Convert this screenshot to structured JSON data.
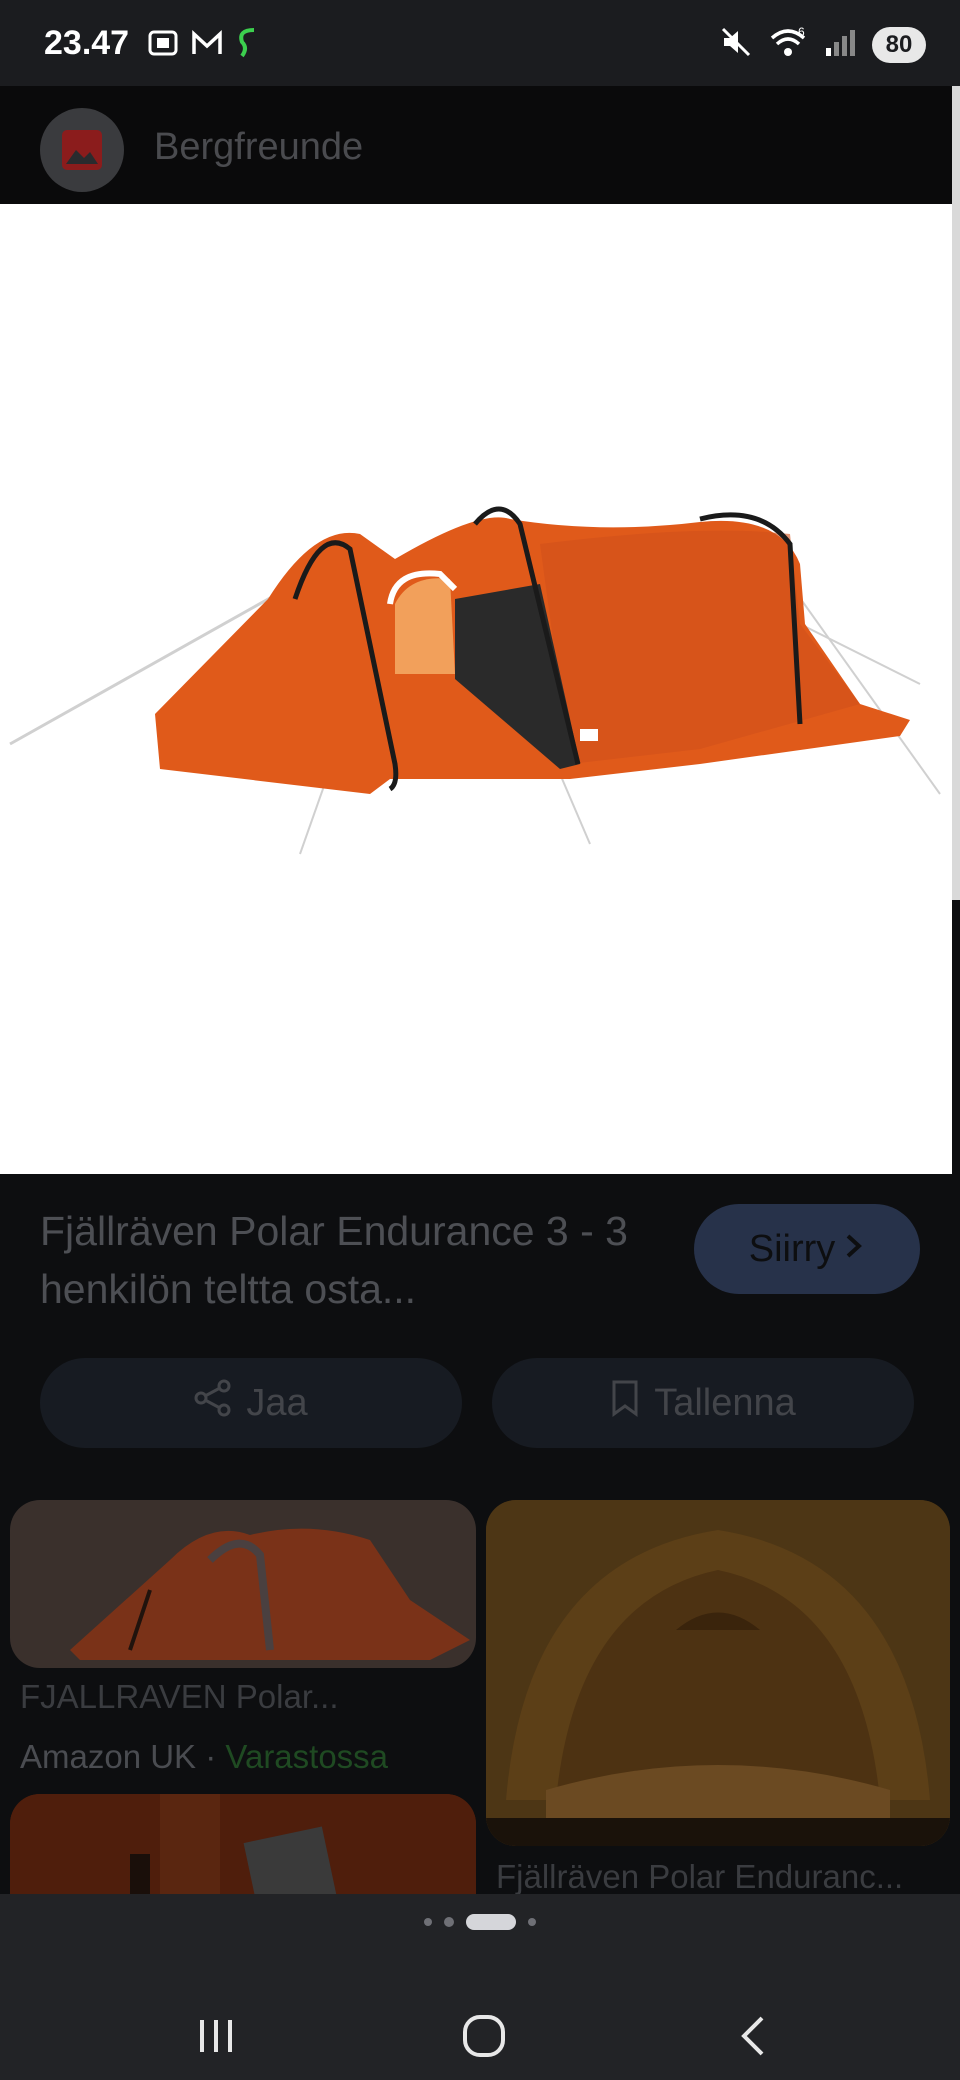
{
  "status_bar": {
    "time": "23.47",
    "battery": "80",
    "left_icons": [
      "screenshot-icon",
      "gmail-icon",
      "app-s-icon"
    ],
    "right_icons": [
      "mute-icon",
      "wifi-icon",
      "signal-icon",
      "battery-icon"
    ]
  },
  "viewer": {
    "source_name": "Bergfreunde",
    "image_alt_icon": "tent-product-image"
  },
  "product": {
    "title": "Fjällräven Polar Endurance 3 - 3 henkilön teltta osta...",
    "visit_label": "Siirry",
    "share_label": "Jaa",
    "save_label": "Tallenna"
  },
  "related": {
    "items": [
      {
        "title": "FJALLRAVEN Polar...",
        "source": "Amazon UK",
        "separator": " · ",
        "stock": "Varastossa"
      },
      {
        "title": "Fjällräven Polar Enduranc..."
      }
    ]
  },
  "navigation": {
    "page_count": 4,
    "active_page": 3,
    "buttons": [
      "recent-apps-icon",
      "home-icon",
      "back-icon"
    ]
  },
  "colors": {
    "tent_orange": "#e05a1a",
    "accent_green": "#1f4a22",
    "button_dark_blue": "#27324a"
  }
}
